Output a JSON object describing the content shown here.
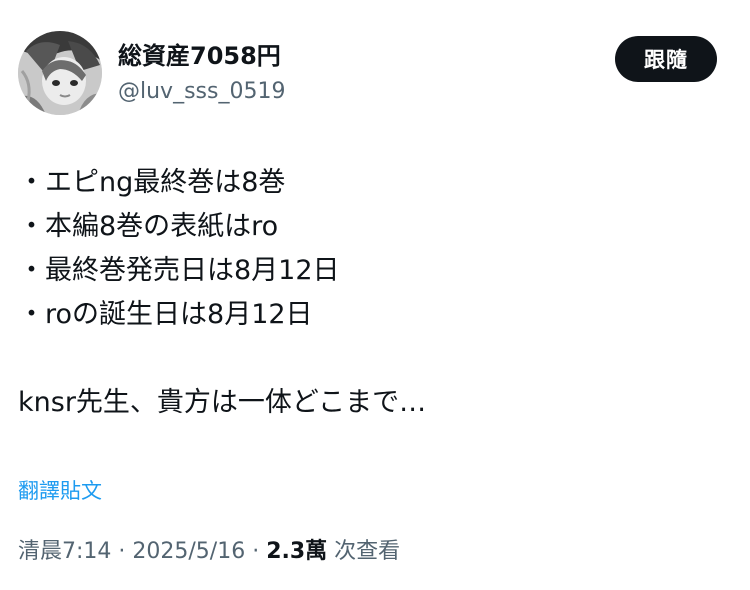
{
  "author": {
    "display_name": "総資産7058円",
    "handle": "@luv_sss_0519"
  },
  "follow_label": "跟隨",
  "tweet": {
    "lines": [
      "・エピng最終巻は8巻",
      "・本編8巻の表紙はro",
      "・最終巻発売日は8月12日",
      "・roの誕生日は8月12日"
    ],
    "closing": "knsr先生、貴方は一体どこまで…"
  },
  "translate_label": "翻譯貼文",
  "meta": {
    "time": "清晨7:14",
    "separator": " · ",
    "date": "2025/5/16",
    "views_count": "2.3萬",
    "views_label": " 次查看"
  }
}
